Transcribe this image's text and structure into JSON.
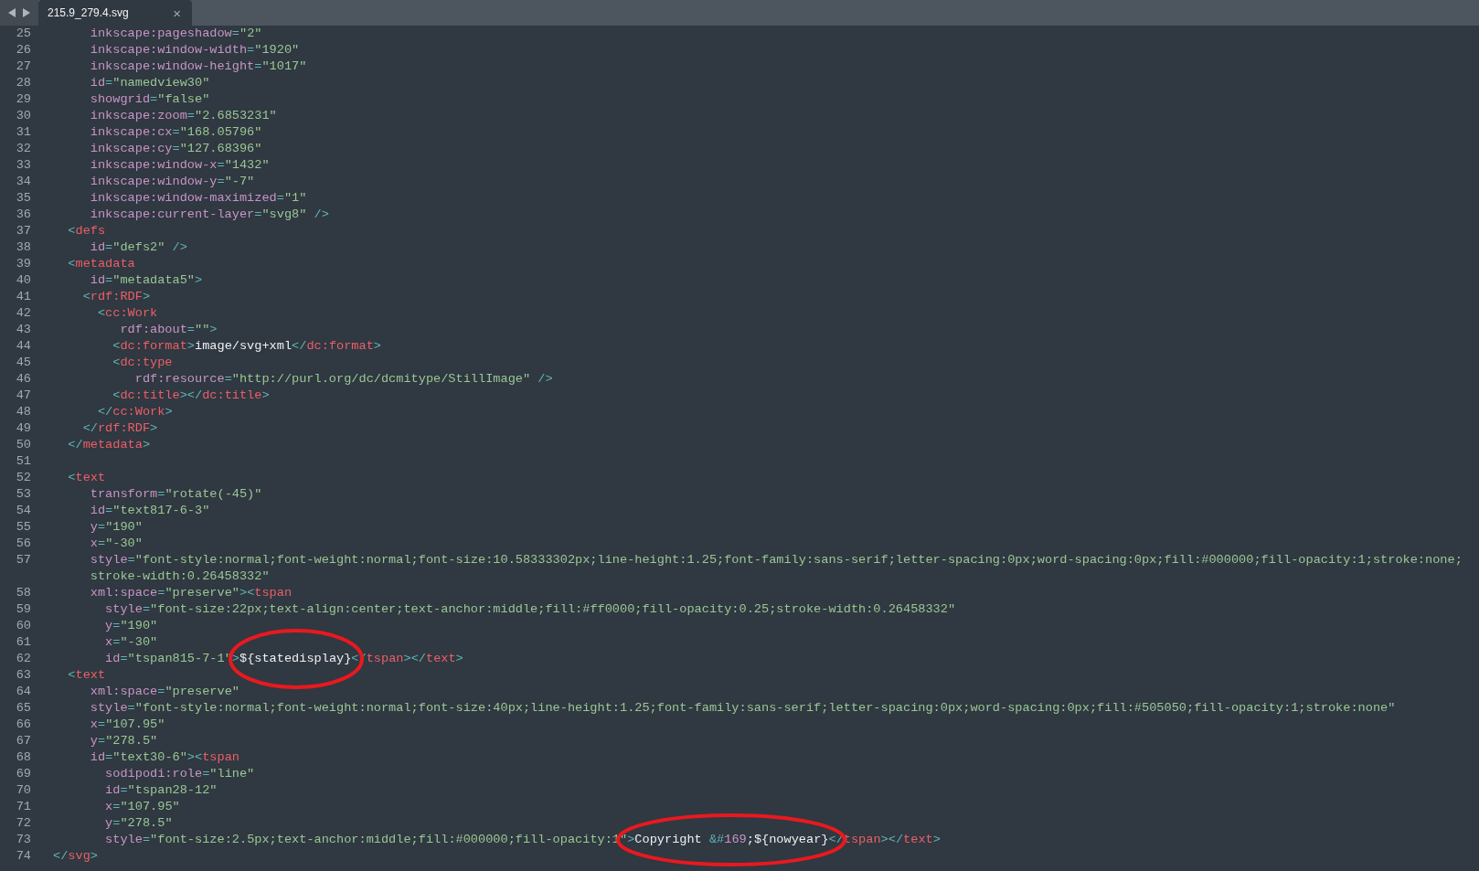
{
  "tab_bar": {
    "tabs": [
      {
        "title": "215.9_279.4.svg",
        "close": "×",
        "selected": true
      }
    ]
  },
  "editor": {
    "lines": [
      {
        "number": "25",
        "tokens": [
          {
            "kind": "attr",
            "text": "     inkscape:pageshadow"
          },
          {
            "kind": "punct",
            "text": "="
          },
          {
            "kind": "string",
            "text": "\"2\""
          }
        ]
      },
      {
        "number": "26",
        "tokens": [
          {
            "kind": "attr",
            "text": "     inkscape:window-width"
          },
          {
            "kind": "punct",
            "text": "="
          },
          {
            "kind": "string",
            "text": "\"1920\""
          }
        ]
      },
      {
        "number": "27",
        "tokens": [
          {
            "kind": "attr",
            "text": "     inkscape:window-height"
          },
          {
            "kind": "punct",
            "text": "="
          },
          {
            "kind": "string",
            "text": "\"1017\""
          }
        ]
      },
      {
        "number": "28",
        "tokens": [
          {
            "kind": "attr",
            "text": "     id"
          },
          {
            "kind": "punct",
            "text": "="
          },
          {
            "kind": "string",
            "text": "\"namedview30\""
          }
        ]
      },
      {
        "number": "29",
        "tokens": [
          {
            "kind": "attr",
            "text": "     showgrid"
          },
          {
            "kind": "punct",
            "text": "="
          },
          {
            "kind": "string",
            "text": "\"false\""
          }
        ]
      },
      {
        "number": "30",
        "tokens": [
          {
            "kind": "attr",
            "text": "     inkscape:zoom"
          },
          {
            "kind": "punct",
            "text": "="
          },
          {
            "kind": "string",
            "text": "\"2.6853231\""
          }
        ]
      },
      {
        "number": "31",
        "tokens": [
          {
            "kind": "attr",
            "text": "     inkscape:cx"
          },
          {
            "kind": "punct",
            "text": "="
          },
          {
            "kind": "string",
            "text": "\"168.05796\""
          }
        ]
      },
      {
        "number": "32",
        "tokens": [
          {
            "kind": "attr",
            "text": "     inkscape:cy"
          },
          {
            "kind": "punct",
            "text": "="
          },
          {
            "kind": "string",
            "text": "\"127.68396\""
          }
        ]
      },
      {
        "number": "33",
        "tokens": [
          {
            "kind": "attr",
            "text": "     inkscape:window-x"
          },
          {
            "kind": "punct",
            "text": "="
          },
          {
            "kind": "string",
            "text": "\"1432\""
          }
        ]
      },
      {
        "number": "34",
        "tokens": [
          {
            "kind": "attr",
            "text": "     inkscape:window-y"
          },
          {
            "kind": "punct",
            "text": "="
          },
          {
            "kind": "string",
            "text": "\"-7\""
          }
        ]
      },
      {
        "number": "35",
        "tokens": [
          {
            "kind": "attr",
            "text": "     inkscape:window-maximized"
          },
          {
            "kind": "punct",
            "text": "="
          },
          {
            "kind": "string",
            "text": "\"1\""
          }
        ]
      },
      {
        "number": "36",
        "tokens": [
          {
            "kind": "attr",
            "text": "     inkscape:current-layer"
          },
          {
            "kind": "punct",
            "text": "="
          },
          {
            "kind": "string",
            "text": "\"svg8\""
          },
          {
            "kind": "punct",
            "text": " />"
          }
        ]
      },
      {
        "number": "37",
        "tokens": [
          {
            "kind": "punct",
            "text": "  <"
          },
          {
            "kind": "tag",
            "text": "defs"
          }
        ]
      },
      {
        "number": "38",
        "tokens": [
          {
            "kind": "attr",
            "text": "     id"
          },
          {
            "kind": "punct",
            "text": "="
          },
          {
            "kind": "string",
            "text": "\"defs2\""
          },
          {
            "kind": "punct",
            "text": " />"
          }
        ]
      },
      {
        "number": "39",
        "tokens": [
          {
            "kind": "punct",
            "text": "  <"
          },
          {
            "kind": "tag",
            "text": "metadata"
          }
        ]
      },
      {
        "number": "40",
        "tokens": [
          {
            "kind": "attr",
            "text": "     id"
          },
          {
            "kind": "punct",
            "text": "="
          },
          {
            "kind": "string",
            "text": "\"metadata5\""
          },
          {
            "kind": "punct",
            "text": ">"
          }
        ]
      },
      {
        "number": "41",
        "tokens": [
          {
            "kind": "punct",
            "text": "    <"
          },
          {
            "kind": "tag",
            "text": "rdf:RDF"
          },
          {
            "kind": "punct",
            "text": ">"
          }
        ]
      },
      {
        "number": "42",
        "tokens": [
          {
            "kind": "punct",
            "text": "      <"
          },
          {
            "kind": "tag",
            "text": "cc:Work"
          }
        ]
      },
      {
        "number": "43",
        "tokens": [
          {
            "kind": "attr",
            "text": "         rdf:about"
          },
          {
            "kind": "punct",
            "text": "="
          },
          {
            "kind": "string",
            "text": "\"\""
          },
          {
            "kind": "punct",
            "text": ">"
          }
        ]
      },
      {
        "number": "44",
        "tokens": [
          {
            "kind": "punct",
            "text": "        <"
          },
          {
            "kind": "tag",
            "text": "dc:format"
          },
          {
            "kind": "punct",
            "text": ">"
          },
          {
            "kind": "text",
            "text": "image/svg+xml"
          },
          {
            "kind": "punct",
            "text": "</"
          },
          {
            "kind": "tag",
            "text": "dc:format"
          },
          {
            "kind": "punct",
            "text": ">"
          }
        ]
      },
      {
        "number": "45",
        "tokens": [
          {
            "kind": "punct",
            "text": "        <"
          },
          {
            "kind": "tag",
            "text": "dc:type"
          }
        ]
      },
      {
        "number": "46",
        "tokens": [
          {
            "kind": "attr",
            "text": "           rdf:resource"
          },
          {
            "kind": "punct",
            "text": "="
          },
          {
            "kind": "string",
            "text": "\"http://purl.org/dc/dcmitype/StillImage\""
          },
          {
            "kind": "punct",
            "text": " />"
          }
        ]
      },
      {
        "number": "47",
        "tokens": [
          {
            "kind": "punct",
            "text": "        <"
          },
          {
            "kind": "tag",
            "text": "dc:title"
          },
          {
            "kind": "punct",
            "text": "></"
          },
          {
            "kind": "tag",
            "text": "dc:title"
          },
          {
            "kind": "punct",
            "text": ">"
          }
        ]
      },
      {
        "number": "48",
        "tokens": [
          {
            "kind": "punct",
            "text": "      </"
          },
          {
            "kind": "tag",
            "text": "cc:Work"
          },
          {
            "kind": "punct",
            "text": ">"
          }
        ]
      },
      {
        "number": "49",
        "tokens": [
          {
            "kind": "punct",
            "text": "    </"
          },
          {
            "kind": "tag",
            "text": "rdf:RDF"
          },
          {
            "kind": "punct",
            "text": ">"
          }
        ]
      },
      {
        "number": "50",
        "tokens": [
          {
            "kind": "punct",
            "text": "  </"
          },
          {
            "kind": "tag",
            "text": "metadata"
          },
          {
            "kind": "punct",
            "text": ">"
          }
        ]
      },
      {
        "number": "51"
      },
      {
        "number": "52",
        "tokens": [
          {
            "kind": "punct",
            "text": "  <"
          },
          {
            "kind": "tag",
            "text": "text"
          }
        ]
      },
      {
        "number": "53",
        "tokens": [
          {
            "kind": "attr",
            "text": "     transform"
          },
          {
            "kind": "punct",
            "text": "="
          },
          {
            "kind": "string",
            "text": "\"rotate(-45)\""
          }
        ]
      },
      {
        "number": "54",
        "tokens": [
          {
            "kind": "attr",
            "text": "     id"
          },
          {
            "kind": "punct",
            "text": "="
          },
          {
            "kind": "string",
            "text": "\"text817-6-3\""
          }
        ]
      },
      {
        "number": "55",
        "tokens": [
          {
            "kind": "attr",
            "text": "     y"
          },
          {
            "kind": "punct",
            "text": "="
          },
          {
            "kind": "string",
            "text": "\"190\""
          }
        ]
      },
      {
        "number": "56",
        "tokens": [
          {
            "kind": "attr",
            "text": "     x"
          },
          {
            "kind": "punct",
            "text": "="
          },
          {
            "kind": "string",
            "text": "\"-30\""
          }
        ]
      },
      {
        "number": "57",
        "tokens": [
          {
            "kind": "attr",
            "text": "     style"
          },
          {
            "kind": "punct",
            "text": "="
          },
          {
            "kind": "string",
            "text": "\"font-style:normal;font-weight:normal;font-size:10.58333302px;line-height:1.25;font-family:sans-serif;letter-spacing:0px;word-spacing:0px;fill:#000000;fill-opacity:1;stroke:none;"
          }
        ],
        "continued": [
          {
            "kind": "string",
            "text": "     stroke-width:0.26458332\""
          }
        ]
      },
      {
        "number": "58",
        "tokens": [
          {
            "kind": "attr",
            "text": "     xml:space"
          },
          {
            "kind": "punct",
            "text": "="
          },
          {
            "kind": "string",
            "text": "\"preserve\""
          },
          {
            "kind": "punct",
            "text": "><"
          },
          {
            "kind": "tag",
            "text": "tspan"
          }
        ]
      },
      {
        "number": "59",
        "tokens": [
          {
            "kind": "attr",
            "text": "       style"
          },
          {
            "kind": "punct",
            "text": "="
          },
          {
            "kind": "string",
            "text": "\"font-size:22px;text-align:center;text-anchor:middle;fill:#ff0000;fill-opacity:0.25;stroke-width:0.26458332\""
          }
        ]
      },
      {
        "number": "60",
        "tokens": [
          {
            "kind": "attr",
            "text": "       y"
          },
          {
            "kind": "punct",
            "text": "="
          },
          {
            "kind": "string",
            "text": "\"190\""
          }
        ]
      },
      {
        "number": "61",
        "tokens": [
          {
            "kind": "attr",
            "text": "       x"
          },
          {
            "kind": "punct",
            "text": "="
          },
          {
            "kind": "string",
            "text": "\"-30\""
          }
        ]
      },
      {
        "number": "62",
        "tokens": [
          {
            "kind": "attr",
            "text": "       id"
          },
          {
            "kind": "punct",
            "text": "="
          },
          {
            "kind": "string",
            "text": "\"tspan815-7-1\""
          },
          {
            "kind": "punct",
            "text": ">"
          },
          {
            "kind": "text",
            "text": "${statedisplay}"
          },
          {
            "kind": "punct",
            "text": "</"
          },
          {
            "kind": "tag",
            "text": "tspan"
          },
          {
            "kind": "punct",
            "text": "></"
          },
          {
            "kind": "tag",
            "text": "text"
          },
          {
            "kind": "punct",
            "text": ">"
          }
        ]
      },
      {
        "number": "63",
        "tokens": [
          {
            "kind": "punct",
            "text": "  <"
          },
          {
            "kind": "tag",
            "text": "text"
          }
        ]
      },
      {
        "number": "64",
        "tokens": [
          {
            "kind": "attr",
            "text": "     xml:space"
          },
          {
            "kind": "punct",
            "text": "="
          },
          {
            "kind": "string",
            "text": "\"preserve\""
          }
        ]
      },
      {
        "number": "65",
        "tokens": [
          {
            "kind": "attr",
            "text": "     style"
          },
          {
            "kind": "punct",
            "text": "="
          },
          {
            "kind": "string",
            "text": "\"font-style:normal;font-weight:normal;font-size:40px;line-height:1.25;font-family:sans-serif;letter-spacing:0px;word-spacing:0px;fill:#505050;fill-opacity:1;stroke:none\""
          }
        ]
      },
      {
        "number": "66",
        "tokens": [
          {
            "kind": "attr",
            "text": "     x"
          },
          {
            "kind": "punct",
            "text": "="
          },
          {
            "kind": "string",
            "text": "\"107.95\""
          }
        ]
      },
      {
        "number": "67",
        "tokens": [
          {
            "kind": "attr",
            "text": "     y"
          },
          {
            "kind": "punct",
            "text": "="
          },
          {
            "kind": "string",
            "text": "\"278.5\""
          }
        ]
      },
      {
        "number": "68",
        "tokens": [
          {
            "kind": "attr",
            "text": "     id"
          },
          {
            "kind": "punct",
            "text": "="
          },
          {
            "kind": "string",
            "text": "\"text30-6\""
          },
          {
            "kind": "punct",
            "text": "><"
          },
          {
            "kind": "tag",
            "text": "tspan"
          }
        ]
      },
      {
        "number": "69",
        "tokens": [
          {
            "kind": "attr",
            "text": "       sodipodi:role"
          },
          {
            "kind": "punct",
            "text": "="
          },
          {
            "kind": "string",
            "text": "\"line\""
          }
        ]
      },
      {
        "number": "70",
        "tokens": [
          {
            "kind": "attr",
            "text": "       id"
          },
          {
            "kind": "punct",
            "text": "="
          },
          {
            "kind": "string",
            "text": "\"tspan28-12\""
          }
        ]
      },
      {
        "number": "71",
        "tokens": [
          {
            "kind": "attr",
            "text": "       x"
          },
          {
            "kind": "punct",
            "text": "="
          },
          {
            "kind": "string",
            "text": "\"107.95\""
          }
        ]
      },
      {
        "number": "72",
        "tokens": [
          {
            "kind": "attr",
            "text": "       y"
          },
          {
            "kind": "punct",
            "text": "="
          },
          {
            "kind": "string",
            "text": "\"278.5\""
          }
        ]
      },
      {
        "number": "73",
        "tokens": [
          {
            "kind": "attr",
            "text": "       style"
          },
          {
            "kind": "punct",
            "text": "="
          },
          {
            "kind": "string",
            "text": "\"font-size:2.5px;text-anchor:middle;fill:#000000;fill-opacity:1\""
          },
          {
            "kind": "punct",
            "text": ">"
          },
          {
            "kind": "text",
            "text": "Copyright "
          },
          {
            "kind": "punct",
            "text": "&#"
          },
          {
            "kind": "attr",
            "text": "169"
          },
          {
            "kind": "text",
            "text": ";${nowyear}"
          },
          {
            "kind": "punct",
            "text": "</"
          },
          {
            "kind": "tag",
            "text": "tspan"
          },
          {
            "kind": "punct",
            "text": "></"
          },
          {
            "kind": "tag",
            "text": "text"
          },
          {
            "kind": "punct",
            "text": ">"
          }
        ]
      },
      {
        "number": "74",
        "tokens": [
          {
            "kind": "punct",
            "text": "</"
          },
          {
            "kind": "tag",
            "text": "svg"
          },
          {
            "kind": "punct",
            "text": ">"
          }
        ]
      }
    ]
  }
}
